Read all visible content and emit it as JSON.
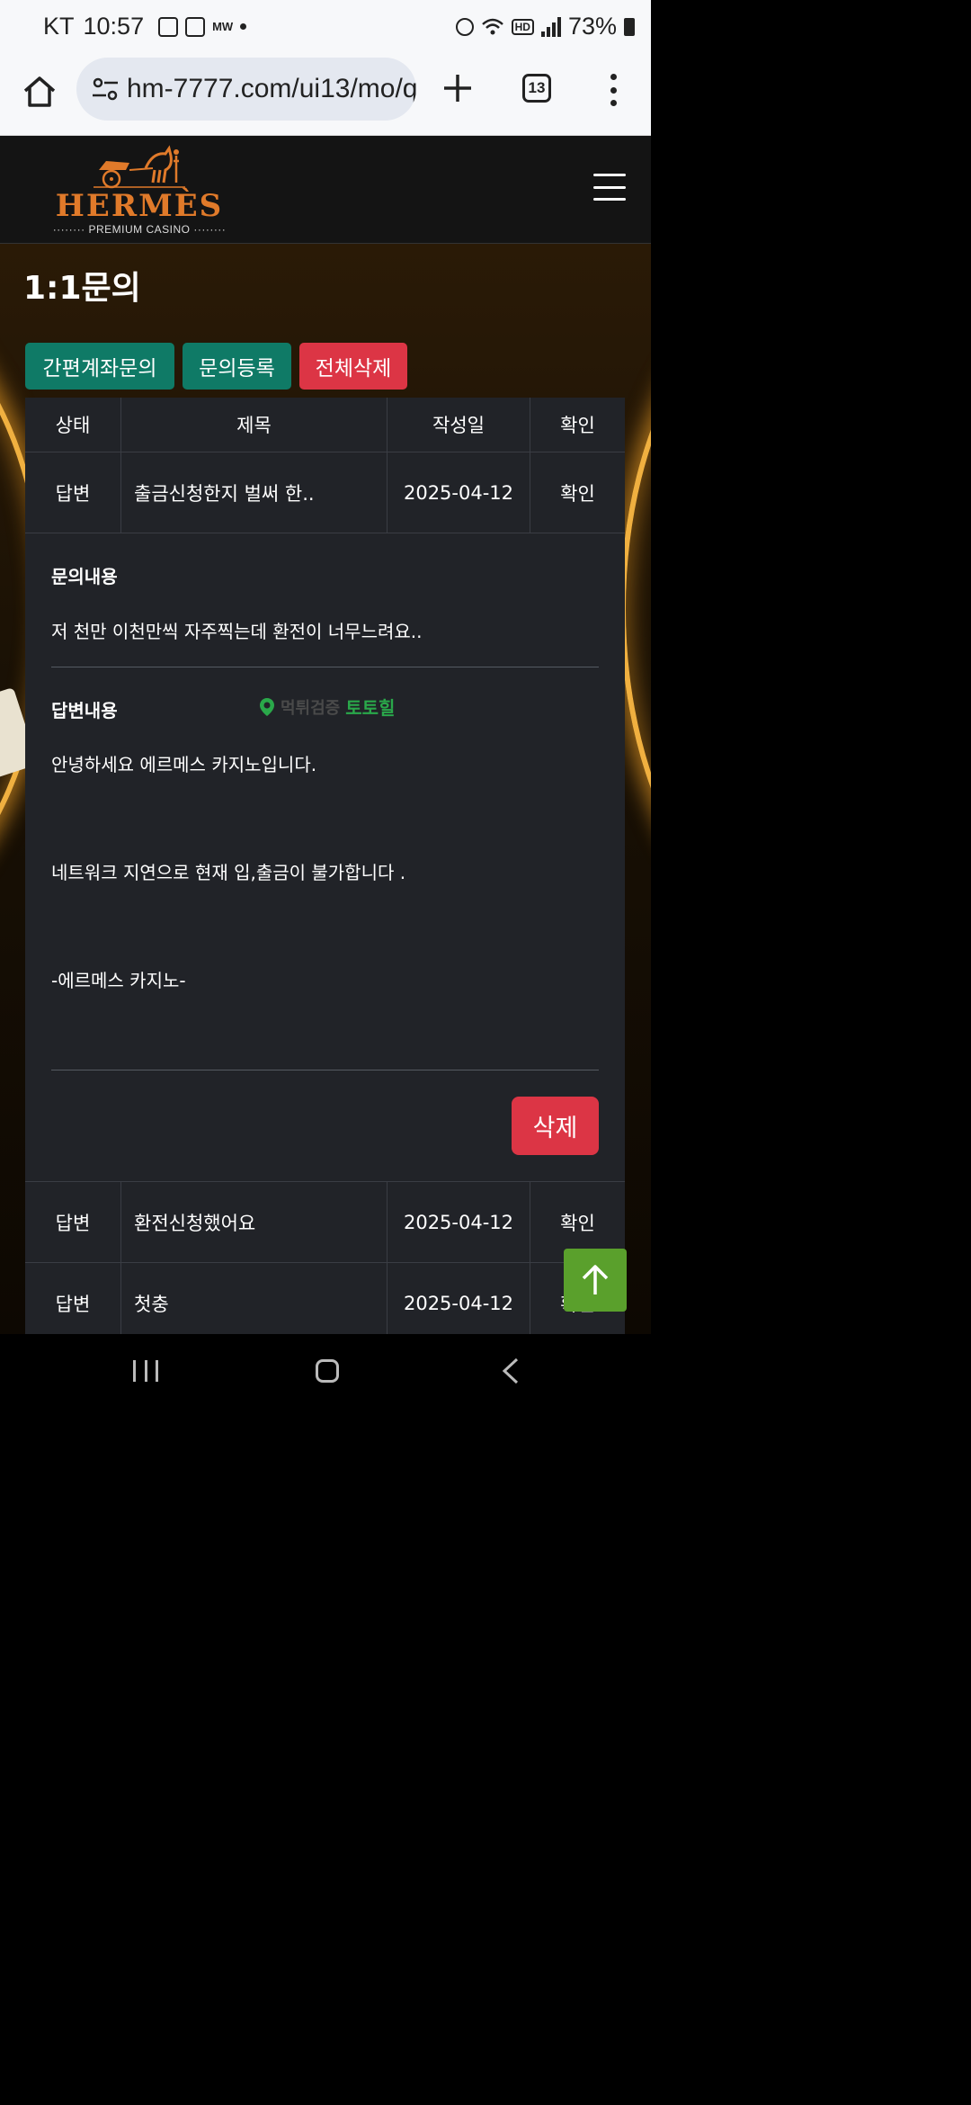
{
  "status_bar": {
    "carrier": "KT",
    "time": "10:57",
    "notif_text": "MW",
    "battery": "73%"
  },
  "browser": {
    "url": "hm-7777.com/ui13/mo/q",
    "tab_count": "13"
  },
  "site": {
    "logo_word": "HERMÈS",
    "logo_sub": "········  PREMIUM CASINO  ········"
  },
  "page": {
    "title": "1:1문의",
    "buttons": {
      "quick_account": "간편계좌문의",
      "register": "문의등록",
      "delete_all": "전체삭제"
    }
  },
  "table": {
    "headers": [
      "상태",
      "제목",
      "작성일",
      "확인"
    ],
    "rows": [
      {
        "status": "답변",
        "subject": "출금신청한지 벌써 한..",
        "date": "2025-04-12",
        "check": "확인"
      },
      {
        "status": "답변",
        "subject": "환전신청했어요",
        "date": "2025-04-12",
        "check": "확인"
      },
      {
        "status": "답변",
        "subject": "첫충",
        "date": "2025-04-12",
        "check": "확인"
      }
    ]
  },
  "detail": {
    "inquiry_label": "문의내용",
    "inquiry_text": "저 천만 이천만씩 자주찍는데 환전이 너무느려요..",
    "answer_label": "답변내용",
    "answer_lines": [
      "안녕하세요 에르메스 카지노입니다.",
      "네트워크 지연으로 현재 입,출금이 불가합니다 .",
      "-에르메스 카지노-"
    ],
    "delete_label": "삭제",
    "watermark_faint": "먹튀검증",
    "watermark_brand": "토토힐"
  },
  "colors": {
    "teal": "#0f7a66",
    "red": "#dc3545",
    "orange_logo": "#e07a2a",
    "scroll_green": "#5aa02c"
  },
  "icons": [
    "home-icon",
    "site-info-icon",
    "plus-icon",
    "tabs-icon",
    "more-vert-icon",
    "hamburger-icon",
    "location-pin-icon",
    "arrow-up-icon",
    "recent-apps-icon",
    "nav-home-icon",
    "back-icon"
  ]
}
